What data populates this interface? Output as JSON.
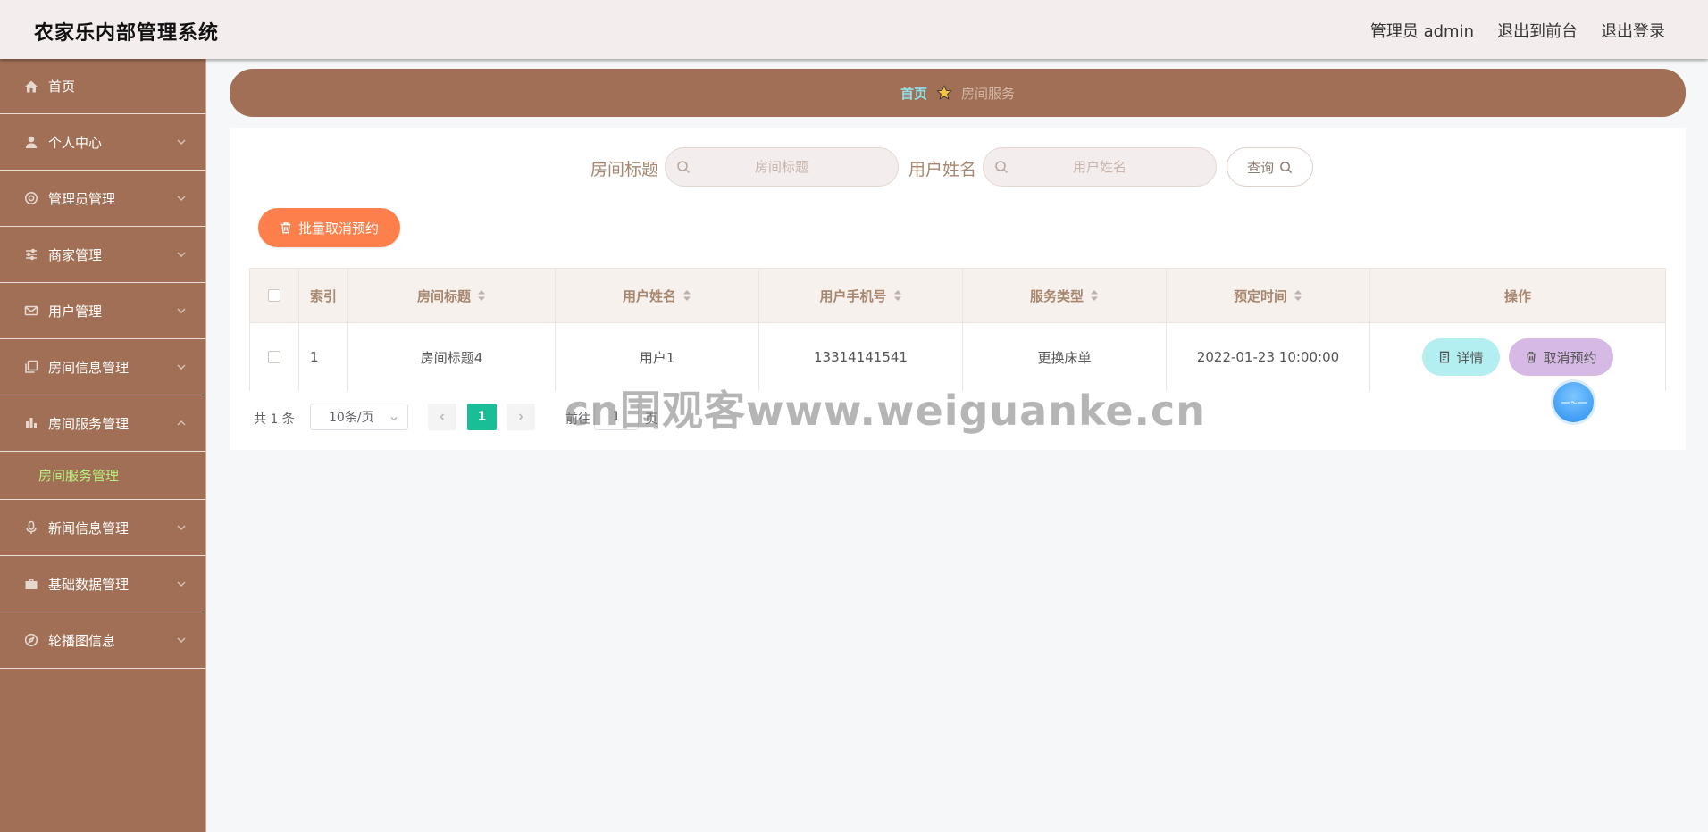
{
  "header": {
    "title": "农家乐内部管理系统",
    "admin_label": "管理员 admin",
    "exit_front_label": "退出到前台",
    "logout_label": "退出登录"
  },
  "sidebar": {
    "items": [
      {
        "label": "首页",
        "icon": "home-icon"
      },
      {
        "label": "个人中心",
        "icon": "user-icon"
      },
      {
        "label": "管理员管理",
        "icon": "settings-icon"
      },
      {
        "label": "商家管理",
        "icon": "sliders-icon"
      },
      {
        "label": "用户管理",
        "icon": "mail-icon"
      },
      {
        "label": "房间信息管理",
        "icon": "copy-icon"
      },
      {
        "label": "房间服务管理",
        "icon": "bar-chart-icon"
      },
      {
        "label": "新闻信息管理",
        "icon": "microphone-icon"
      },
      {
        "label": "基础数据管理",
        "icon": "briefcase-icon"
      },
      {
        "label": "轮播图信息",
        "icon": "compass-icon"
      }
    ],
    "submenu_label": "房间服务管理"
  },
  "breadcrumb": {
    "home": "首页",
    "current": "房间服务"
  },
  "search": {
    "title_label": "房间标题",
    "title_placeholder": "房间标题",
    "user_label": "用户姓名",
    "user_placeholder": "用户姓名",
    "query_label": "查询"
  },
  "batch_cancel_label": "批量取消预约",
  "table": {
    "headers": [
      "索引",
      "房间标题",
      "用户姓名",
      "用户手机号",
      "服务类型",
      "预定时间",
      "操作"
    ],
    "rows": [
      {
        "index": "1",
        "room_title": "房间标题4",
        "user_name": "用户1",
        "phone": "13314141541",
        "service_type": "更换床单",
        "booking_time": "2022-01-23 10:00:00",
        "detail_label": "详情",
        "cancel_label": "取消预约"
      }
    ]
  },
  "pagination": {
    "total_text": "共 1 条",
    "page_size": "10条/页",
    "current_page": "1",
    "goto_prefix": "前往",
    "goto_value": "1",
    "goto_suffix": "页"
  },
  "watermark": "cn围观客www.weiguanke.cn",
  "colors": {
    "sidebar_bg": "#a06f55",
    "header_bg": "#f3eded",
    "accent_active": "#19be97",
    "batch_button": "#fd7f4b",
    "detail_button": "#b3eef0",
    "cancel_button": "#d7b9e6",
    "submenu_active": "#b7f07c"
  }
}
